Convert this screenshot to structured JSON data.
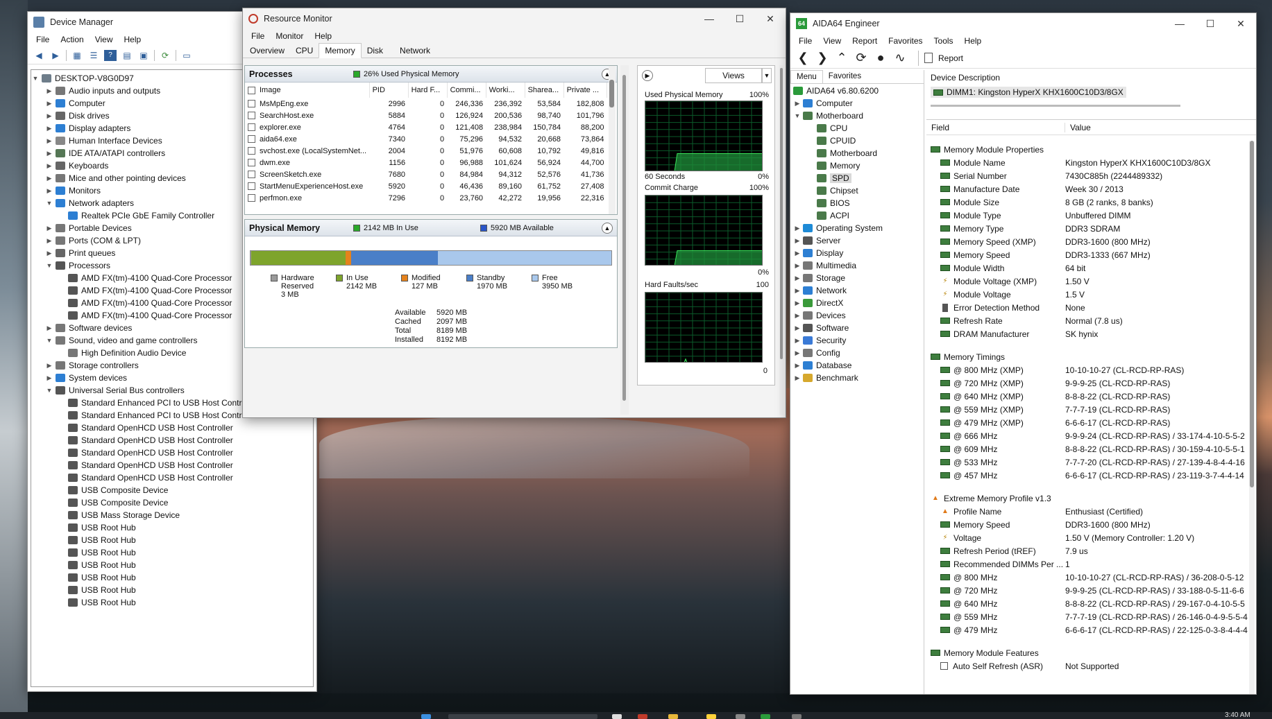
{
  "device_manager": {
    "title": "Device Manager",
    "menu": [
      "File",
      "Action",
      "View",
      "Help"
    ],
    "root": "DESKTOP-V8G0D97",
    "tree": [
      {
        "label": "Audio inputs and outputs",
        "level": 1,
        "state": "closed",
        "color": "#777"
      },
      {
        "label": "Computer",
        "level": 1,
        "state": "closed",
        "color": "#2d7fd3"
      },
      {
        "label": "Disk drives",
        "level": 1,
        "state": "closed",
        "color": "#666"
      },
      {
        "label": "Display adapters",
        "level": 1,
        "state": "closed",
        "color": "#2d7fd3"
      },
      {
        "label": "Human Interface Devices",
        "level": 1,
        "state": "closed",
        "color": "#888"
      },
      {
        "label": "IDE ATA/ATAPI controllers",
        "level": 1,
        "state": "closed",
        "color": "#557755"
      },
      {
        "label": "Keyboards",
        "level": 1,
        "state": "closed",
        "color": "#666"
      },
      {
        "label": "Mice and other pointing devices",
        "level": 1,
        "state": "closed",
        "color": "#777"
      },
      {
        "label": "Monitors",
        "level": 1,
        "state": "closed",
        "color": "#2d7fd3"
      },
      {
        "label": "Network adapters",
        "level": 1,
        "state": "open",
        "color": "#2d7fd3"
      },
      {
        "label": "Realtek PCIe GbE Family Controller",
        "level": 2,
        "state": "none",
        "color": "#2d7fd3"
      },
      {
        "label": "Portable Devices",
        "level": 1,
        "state": "closed",
        "color": "#777"
      },
      {
        "label": "Ports (COM & LPT)",
        "level": 1,
        "state": "closed",
        "color": "#777"
      },
      {
        "label": "Print queues",
        "level": 1,
        "state": "closed",
        "color": "#666"
      },
      {
        "label": "Processors",
        "level": 1,
        "state": "open",
        "color": "#555"
      },
      {
        "label": "AMD FX(tm)-4100 Quad-Core Processor",
        "level": 2,
        "state": "none",
        "color": "#555"
      },
      {
        "label": "AMD FX(tm)-4100 Quad-Core Processor",
        "level": 2,
        "state": "none",
        "color": "#555"
      },
      {
        "label": "AMD FX(tm)-4100 Quad-Core Processor",
        "level": 2,
        "state": "none",
        "color": "#555"
      },
      {
        "label": "AMD FX(tm)-4100 Quad-Core Processor",
        "level": 2,
        "state": "none",
        "color": "#555"
      },
      {
        "label": "Software devices",
        "level": 1,
        "state": "closed",
        "color": "#777"
      },
      {
        "label": "Sound, video and game controllers",
        "level": 1,
        "state": "open",
        "color": "#777"
      },
      {
        "label": "High Definition Audio Device",
        "level": 2,
        "state": "none",
        "color": "#777"
      },
      {
        "label": "Storage controllers",
        "level": 1,
        "state": "closed",
        "color": "#777"
      },
      {
        "label": "System devices",
        "level": 1,
        "state": "closed",
        "color": "#2d7fd3"
      },
      {
        "label": "Universal Serial Bus controllers",
        "level": 1,
        "state": "open",
        "color": "#555"
      },
      {
        "label": "Standard Enhanced PCI to USB Host Contro",
        "level": 2,
        "state": "none",
        "color": "#555"
      },
      {
        "label": "Standard Enhanced PCI to USB Host Contro",
        "level": 2,
        "state": "none",
        "color": "#555"
      },
      {
        "label": "Standard OpenHCD USB Host Controller",
        "level": 2,
        "state": "none",
        "color": "#555"
      },
      {
        "label": "Standard OpenHCD USB Host Controller",
        "level": 2,
        "state": "none",
        "color": "#555"
      },
      {
        "label": "Standard OpenHCD USB Host Controller",
        "level": 2,
        "state": "none",
        "color": "#555"
      },
      {
        "label": "Standard OpenHCD USB Host Controller",
        "level": 2,
        "state": "none",
        "color": "#555"
      },
      {
        "label": "Standard OpenHCD USB Host Controller",
        "level": 2,
        "state": "none",
        "color": "#555"
      },
      {
        "label": "USB Composite Device",
        "level": 2,
        "state": "none",
        "color": "#555"
      },
      {
        "label": "USB Composite Device",
        "level": 2,
        "state": "none",
        "color": "#555"
      },
      {
        "label": "USB Mass Storage Device",
        "level": 2,
        "state": "none",
        "color": "#555"
      },
      {
        "label": "USB Root Hub",
        "level": 2,
        "state": "none",
        "color": "#555"
      },
      {
        "label": "USB Root Hub",
        "level": 2,
        "state": "none",
        "color": "#555"
      },
      {
        "label": "USB Root Hub",
        "level": 2,
        "state": "none",
        "color": "#555"
      },
      {
        "label": "USB Root Hub",
        "level": 2,
        "state": "none",
        "color": "#555"
      },
      {
        "label": "USB Root Hub",
        "level": 2,
        "state": "none",
        "color": "#555"
      },
      {
        "label": "USB Root Hub",
        "level": 2,
        "state": "none",
        "color": "#555"
      },
      {
        "label": "USB Root Hub",
        "level": 2,
        "state": "none",
        "color": "#555"
      }
    ]
  },
  "resource_monitor": {
    "title": "Resource Monitor",
    "menu": [
      "File",
      "Monitor",
      "Help"
    ],
    "tabs": [
      "Overview",
      "CPU",
      "Memory",
      "Disk",
      "Network"
    ],
    "selected_tab": "Memory",
    "processes": {
      "title": "Processes",
      "status": "26% Used Physical Memory",
      "columns": [
        "Image",
        "PID",
        "Hard F...",
        "Commi...",
        "Worki...",
        "Sharea...",
        "Private ..."
      ],
      "rows": [
        [
          "MsMpEng.exe",
          "2996",
          "0",
          "246,336",
          "236,392",
          "53,584",
          "182,808"
        ],
        [
          "SearchHost.exe",
          "5884",
          "0",
          "126,924",
          "200,536",
          "98,740",
          "101,796"
        ],
        [
          "explorer.exe",
          "4764",
          "0",
          "121,408",
          "238,984",
          "150,784",
          "88,200"
        ],
        [
          "aida64.exe",
          "7340",
          "0",
          "75,296",
          "94,532",
          "20,668",
          "73,864"
        ],
        [
          "svchost.exe (LocalSystemNet...",
          "2004",
          "0",
          "51,976",
          "60,608",
          "10,792",
          "49,816"
        ],
        [
          "dwm.exe",
          "1156",
          "0",
          "96,988",
          "101,624",
          "56,924",
          "44,700"
        ],
        [
          "ScreenSketch.exe",
          "7680",
          "0",
          "84,984",
          "94,312",
          "52,576",
          "41,736"
        ],
        [
          "StartMenuExperienceHost.exe",
          "5920",
          "0",
          "46,436",
          "89,160",
          "61,752",
          "27,408"
        ],
        [
          "perfmon.exe",
          "7296",
          "0",
          "23,760",
          "42,272",
          "19,956",
          "22,316"
        ]
      ]
    },
    "physical_memory": {
      "title": "Physical Memory",
      "in_use": "2142 MB In Use",
      "available": "5920 MB Available",
      "bar_fractions": {
        "reserved": 0.0004,
        "in_use": 0.2615,
        "modified": 0.0155,
        "standby": 0.2404,
        "free": 0.4822
      },
      "colors": {
        "reserved": "#9a9a9a",
        "in_use": "#7ea42c",
        "modified": "#e5821c",
        "standby": "#4a7fc8",
        "free": "#a9c8ec"
      },
      "legend": [
        {
          "key": "reserved",
          "name": "Hardware\nReserved",
          "value": "3 MB"
        },
        {
          "key": "in_use",
          "name": "In Use",
          "value": "2142 MB"
        },
        {
          "key": "modified",
          "name": "Modified",
          "value": "127 MB"
        },
        {
          "key": "standby",
          "name": "Standby",
          "value": "1970 MB"
        },
        {
          "key": "free",
          "name": "Free",
          "value": "3950 MB"
        }
      ],
      "stats": [
        {
          "label": "Available",
          "value": "5920 MB"
        },
        {
          "label": "Cached",
          "value": "2097 MB"
        },
        {
          "label": "Total",
          "value": "8189 MB"
        },
        {
          "label": "Installed",
          "value": "8192 MB"
        }
      ]
    },
    "graphs": {
      "views_label": "Views",
      "used_physical": {
        "title": "Used Physical Memory",
        "max": "100%",
        "min": "0%",
        "footer": "60 Seconds",
        "level": 0.26
      },
      "commit": {
        "title": "Commit Charge",
        "max": "100%",
        "min": "0%",
        "level": 0.22
      },
      "hard_faults": {
        "title": "Hard Faults/sec",
        "max": "100",
        "min": "0"
      }
    }
  },
  "aida64": {
    "title": "AIDA64 Engineer",
    "menu": [
      "File",
      "View",
      "Report",
      "Favorites",
      "Tools",
      "Help"
    ],
    "report_label": "Report",
    "left_tabs": [
      "Menu",
      "Favorites"
    ],
    "version": "AIDA64 v6.80.6200",
    "nav": [
      {
        "label": "Computer",
        "level": 1,
        "state": "closed",
        "color": "#2d7fd3"
      },
      {
        "label": "Motherboard",
        "level": 1,
        "state": "open",
        "color": "#4a7a4a"
      },
      {
        "label": "CPU",
        "level": 2,
        "state": "none",
        "color": "#4a7a4a"
      },
      {
        "label": "CPUID",
        "level": 2,
        "state": "none",
        "color": "#4a7a4a"
      },
      {
        "label": "Motherboard",
        "level": 2,
        "state": "none",
        "color": "#4a7a4a"
      },
      {
        "label": "Memory",
        "level": 2,
        "state": "none",
        "color": "#4a7a4a"
      },
      {
        "label": "SPD",
        "level": 2,
        "state": "selected",
        "color": "#4a7a4a"
      },
      {
        "label": "Chipset",
        "level": 2,
        "state": "none",
        "color": "#4a7a4a"
      },
      {
        "label": "BIOS",
        "level": 2,
        "state": "none",
        "color": "#4a7a4a"
      },
      {
        "label": "ACPI",
        "level": 2,
        "state": "none",
        "color": "#4a7a4a"
      },
      {
        "label": "Operating System",
        "level": 1,
        "state": "closed",
        "color": "#1e8ad6"
      },
      {
        "label": "Server",
        "level": 1,
        "state": "closed",
        "color": "#555"
      },
      {
        "label": "Display",
        "level": 1,
        "state": "closed",
        "color": "#2d7fd3"
      },
      {
        "label": "Multimedia",
        "level": 1,
        "state": "closed",
        "color": "#777"
      },
      {
        "label": "Storage",
        "level": 1,
        "state": "closed",
        "color": "#777"
      },
      {
        "label": "Network",
        "level": 1,
        "state": "closed",
        "color": "#2d7fd3"
      },
      {
        "label": "DirectX",
        "level": 1,
        "state": "closed",
        "color": "#3a9a3a"
      },
      {
        "label": "Devices",
        "level": 1,
        "state": "closed",
        "color": "#777"
      },
      {
        "label": "Software",
        "level": 1,
        "state": "closed",
        "color": "#555"
      },
      {
        "label": "Security",
        "level": 1,
        "state": "closed",
        "color": "#3a7ad6"
      },
      {
        "label": "Config",
        "level": 1,
        "state": "closed",
        "color": "#777"
      },
      {
        "label": "Database",
        "level": 1,
        "state": "closed",
        "color": "#2d7fd3"
      },
      {
        "label": "Benchmark",
        "level": 1,
        "state": "closed",
        "color": "#d6a82d"
      }
    ],
    "device_description_label": "Device Description",
    "device": "DIMM1: Kingston HyperX KHX1600C10D3/8GX",
    "col_field": "Field",
    "col_value": "Value",
    "rows": [
      {
        "type": "section",
        "icon": "memory-chip-icon",
        "field": "Memory Module Properties",
        "value": ""
      },
      {
        "type": "item",
        "icon": "memory-chip-icon",
        "field": "Module Name",
        "value": "Kingston HyperX KHX1600C10D3/8GX"
      },
      {
        "type": "item",
        "icon": "memory-chip-icon",
        "field": "Serial Number",
        "value": "7430C885h (2244489332)"
      },
      {
        "type": "item",
        "icon": "memory-chip-icon",
        "field": "Manufacture Date",
        "value": "Week 30 / 2013"
      },
      {
        "type": "item",
        "icon": "memory-chip-icon",
        "field": "Module Size",
        "value": "8 GB (2 ranks, 8 banks)"
      },
      {
        "type": "item",
        "icon": "memory-chip-icon",
        "field": "Module Type",
        "value": "Unbuffered DIMM"
      },
      {
        "type": "item",
        "icon": "memory-chip-icon",
        "field": "Memory Type",
        "value": "DDR3 SDRAM"
      },
      {
        "type": "item",
        "icon": "memory-chip-icon",
        "field": "Memory Speed (XMP)",
        "value": "DDR3-1600 (800 MHz)"
      },
      {
        "type": "item",
        "icon": "memory-chip-icon",
        "field": "Memory Speed",
        "value": "DDR3-1333 (667 MHz)"
      },
      {
        "type": "item",
        "icon": "memory-chip-icon",
        "field": "Module Width",
        "value": "64 bit"
      },
      {
        "type": "item",
        "icon": "voltage-icon",
        "field": "Module Voltage (XMP)",
        "value": "1.50 V"
      },
      {
        "type": "item",
        "icon": "voltage-icon",
        "field": "Module Voltage",
        "value": "1.5 V"
      },
      {
        "type": "item",
        "icon": "error-detection-icon",
        "field": "Error Detection Method",
        "value": "None"
      },
      {
        "type": "item",
        "icon": "memory-chip-icon",
        "field": "Refresh Rate",
        "value": "Normal (7.8 us)"
      },
      {
        "type": "item",
        "icon": "memory-chip-icon",
        "field": "DRAM Manufacturer",
        "value": "SK hynix"
      },
      {
        "type": "blank",
        "icon": "",
        "field": "",
        "value": ""
      },
      {
        "type": "section",
        "icon": "memory-chip-icon",
        "field": "Memory Timings",
        "value": ""
      },
      {
        "type": "item",
        "icon": "memory-chip-icon",
        "field": "@ 800 MHz (XMP)",
        "value": "10-10-10-27  (CL-RCD-RP-RAS)"
      },
      {
        "type": "item",
        "icon": "memory-chip-icon",
        "field": "@ 720 MHz (XMP)",
        "value": "9-9-9-25  (CL-RCD-RP-RAS)"
      },
      {
        "type": "item",
        "icon": "memory-chip-icon",
        "field": "@ 640 MHz (XMP)",
        "value": "8-8-8-22  (CL-RCD-RP-RAS)"
      },
      {
        "type": "item",
        "icon": "memory-chip-icon",
        "field": "@ 559 MHz (XMP)",
        "value": "7-7-7-19  (CL-RCD-RP-RAS)"
      },
      {
        "type": "item",
        "icon": "memory-chip-icon",
        "field": "@ 479 MHz (XMP)",
        "value": "6-6-6-17  (CL-RCD-RP-RAS)"
      },
      {
        "type": "item",
        "icon": "memory-chip-icon",
        "field": "@ 666 MHz",
        "value": "9-9-9-24  (CL-RCD-RP-RAS) / 33-174-4-10-5-5-2"
      },
      {
        "type": "item",
        "icon": "memory-chip-icon",
        "field": "@ 609 MHz",
        "value": "8-8-8-22  (CL-RCD-RP-RAS) / 30-159-4-10-5-5-1"
      },
      {
        "type": "item",
        "icon": "memory-chip-icon",
        "field": "@ 533 MHz",
        "value": "7-7-7-20  (CL-RCD-RP-RAS) / 27-139-4-8-4-4-16"
      },
      {
        "type": "item",
        "icon": "memory-chip-icon",
        "field": "@ 457 MHz",
        "value": "6-6-6-17  (CL-RCD-RP-RAS) / 23-119-3-7-4-4-14"
      },
      {
        "type": "blank",
        "icon": "",
        "field": "",
        "value": ""
      },
      {
        "type": "section",
        "icon": "flame-icon",
        "field": "Extreme Memory Profile v1.3",
        "value": ""
      },
      {
        "type": "item",
        "icon": "flame-icon",
        "field": "Profile Name",
        "value": "Enthusiast (Certified)"
      },
      {
        "type": "item",
        "icon": "memory-chip-icon",
        "field": "Memory Speed",
        "value": "DDR3-1600 (800 MHz)"
      },
      {
        "type": "item",
        "icon": "voltage-icon",
        "field": "Voltage",
        "value": "1.50 V  (Memory Controller: 1.20 V)"
      },
      {
        "type": "item",
        "icon": "memory-chip-icon",
        "field": "Refresh Period (tREF)",
        "value": "7.9 us"
      },
      {
        "type": "item",
        "icon": "memory-chip-icon",
        "field": "Recommended DIMMs Per ...",
        "value": "1"
      },
      {
        "type": "item",
        "icon": "memory-chip-icon",
        "field": "@ 800 MHz",
        "value": "10-10-10-27  (CL-RCD-RP-RAS) / 36-208-0-5-12"
      },
      {
        "type": "item",
        "icon": "memory-chip-icon",
        "field": "@ 720 MHz",
        "value": "9-9-9-25  (CL-RCD-RP-RAS) / 33-188-0-5-11-6-6"
      },
      {
        "type": "item",
        "icon": "memory-chip-icon",
        "field": "@ 640 MHz",
        "value": "8-8-8-22  (CL-RCD-RP-RAS) / 29-167-0-4-10-5-5"
      },
      {
        "type": "item",
        "icon": "memory-chip-icon",
        "field": "@ 559 MHz",
        "value": "7-7-7-19  (CL-RCD-RP-RAS) / 26-146-0-4-9-5-5-4"
      },
      {
        "type": "item",
        "icon": "memory-chip-icon",
        "field": "@ 479 MHz",
        "value": "6-6-6-17  (CL-RCD-RP-RAS) / 22-125-0-3-8-4-4-4"
      },
      {
        "type": "blank",
        "icon": "",
        "field": "",
        "value": ""
      },
      {
        "type": "section",
        "icon": "memory-chip-icon",
        "field": "Memory Module Features",
        "value": ""
      },
      {
        "type": "check",
        "icon": "checkbox-icon",
        "field": "Auto Self Refresh (ASR)",
        "value": "Not Supported"
      }
    ]
  },
  "taskbar": {
    "time": "3:40 AM"
  }
}
